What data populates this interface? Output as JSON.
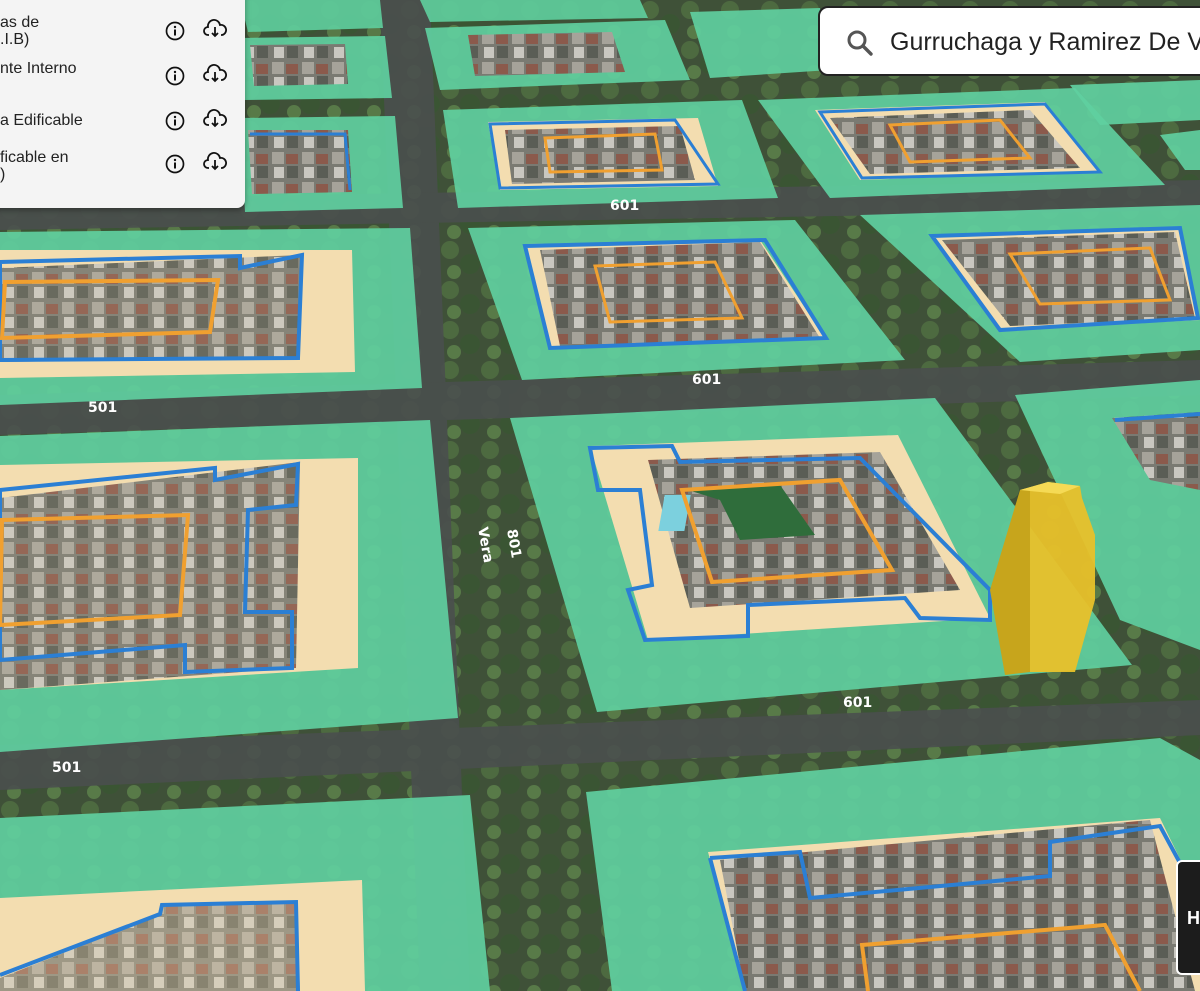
{
  "layers_panel": {
    "items": [
      {
        "label": "as de\n.I.B)",
        "info_icon": "info-icon",
        "download_icon": "cloud-download-icon"
      },
      {
        "label": "nte Interno",
        "info_icon": "info-icon",
        "download_icon": "cloud-download-icon"
      },
      {
        "label": "a Edificable",
        "info_icon": "info-icon",
        "download_icon": "cloud-download-icon"
      },
      {
        "label": "ficable en\n)",
        "info_icon": "info-icon",
        "download_icon": "cloud-download-icon"
      }
    ]
  },
  "search": {
    "value": "Gurruchaga y Ramirez De Vela",
    "icon": "search-icon"
  },
  "map": {
    "street_labels": [
      "601",
      "601",
      "601",
      "501",
      "501",
      "Vera",
      "801",
      "601"
    ],
    "corner_control_label": "H",
    "colors": {
      "buildable_fill": "#5fcf9f",
      "inner_fill": "#f3ddb0",
      "blue_outline": "#2b7fd4",
      "orange_outline": "#f0a030",
      "highlight_building": "#e8c12a"
    }
  }
}
